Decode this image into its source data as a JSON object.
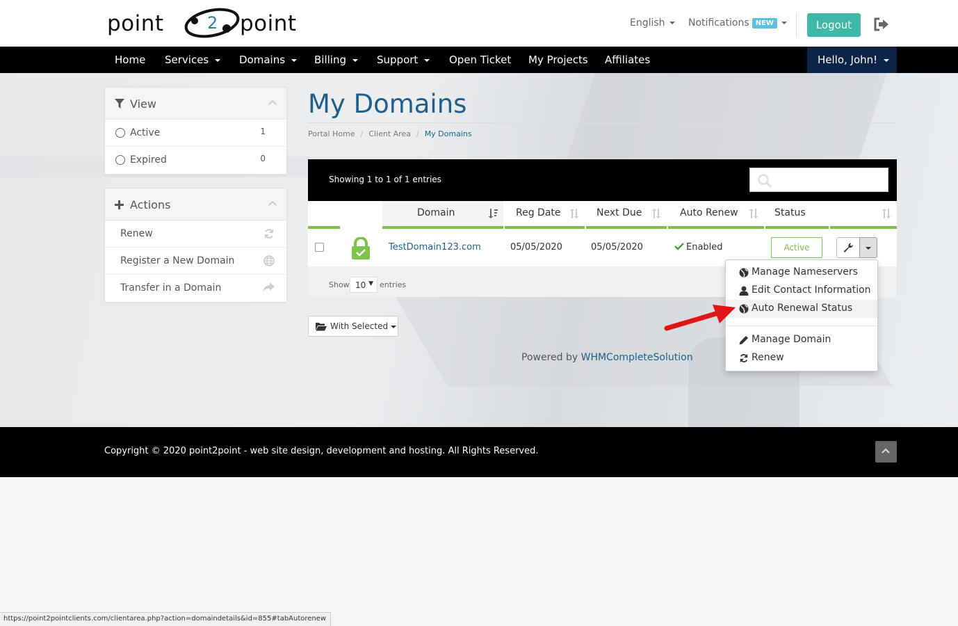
{
  "brand": {
    "left": "point",
    "mark": "2",
    "right": "point"
  },
  "header": {
    "language": "English",
    "notifications": "Notifications",
    "new_badge": "NEW",
    "logout": "Logout"
  },
  "nav": {
    "items": [
      "Home",
      "Services",
      "Domains",
      "Billing",
      "Support",
      "Open Ticket",
      "My Projects",
      "Affiliates"
    ],
    "user": "Hello, John!"
  },
  "sidebar": {
    "view": {
      "title": "View",
      "items": [
        {
          "label": "Active",
          "count": "1"
        },
        {
          "label": "Expired",
          "count": "0"
        }
      ]
    },
    "actions": {
      "title": "Actions",
      "items": [
        {
          "label": "Renew",
          "icon": "refresh-icon"
        },
        {
          "label": "Register a New Domain",
          "icon": "globe-icon"
        },
        {
          "label": "Transfer in a Domain",
          "icon": "share-icon"
        }
      ]
    }
  },
  "main": {
    "title": "My Domains",
    "breadcrumb": [
      "Portal Home",
      "Client Area",
      "My Domains"
    ],
    "showing": "Showing 1 to 1 of 1 entries",
    "columns": [
      "Domain",
      "Reg Date",
      "Next Due",
      "Auto Renew",
      "Status"
    ],
    "rows": [
      {
        "domain": "TestDomain123.com",
        "reg_date": "05/05/2020",
        "next_due": "05/05/2020",
        "auto_renew": "Enabled",
        "status": "Active"
      }
    ],
    "show_label": "Show",
    "show_value": "10",
    "entries_label": "entries",
    "with_selected": "With Selected",
    "powered_by": "Powered by",
    "powered_link": "WHMCompleteSolution"
  },
  "dropdown": {
    "items": [
      {
        "label": "Manage Nameservers",
        "icon": "globe-icon"
      },
      {
        "label": "Edit Contact Information",
        "icon": "user-icon"
      },
      {
        "label": "Auto Renewal Status",
        "icon": "globe-icon"
      },
      {
        "label": "Manage Domain",
        "icon": "pencil-icon"
      },
      {
        "label": "Renew",
        "icon": "refresh-icon"
      }
    ]
  },
  "footer": {
    "copyright": "Copyright © 2020 point2point - web site design, development and hosting. All Rights Reserved."
  },
  "status_bar": "https://point2pointclients.com/clientarea.php?action=domaindetails&id=855#tabAutorenew",
  "colors": {
    "accent": "#1f5f8b",
    "logout": "#3fb9a4",
    "active_green": "#7dc24b",
    "nav_bg": "#000000",
    "user_bg": "#0b2447"
  }
}
